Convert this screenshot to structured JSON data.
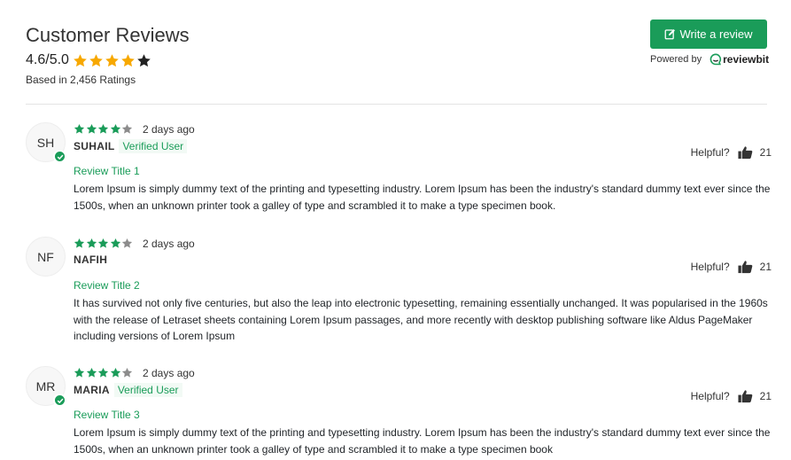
{
  "header": {
    "title": "Customer Reviews",
    "rating_value": "4.6/5.0",
    "rating_stars_filled": 4,
    "rating_stars_total": 5,
    "based_text": "Based in 2,456 Ratings",
    "write_review_label": "Write a review",
    "write_review_icon": "edit-icon",
    "powered_by": "Powered by",
    "logo_text": "reviewbit"
  },
  "colors": {
    "accent_green": "#1a9c59",
    "star_gold": "#f7a800",
    "star_dark": "#222222",
    "star_gray": "#8c8c8c"
  },
  "reviews": [
    {
      "initials": "SH",
      "stars_filled": 4,
      "date": "2 days ago",
      "name": "SUHAIL",
      "verified": "Verified User",
      "helpful_label": "Helpful?",
      "helpful_count": "21",
      "title": "Review Title 1",
      "body": "Lorem Ipsum is simply dummy text of the printing and typesetting industry. Lorem Ipsum has been the industry's standard dummy text ever since the 1500s, when an unknown printer took a galley of type and scrambled it to make a type specimen book."
    },
    {
      "initials": "NF",
      "stars_filled": 4,
      "date": "2 days ago",
      "name": "NAFIH",
      "verified": "",
      "helpful_label": "Helpful?",
      "helpful_count": "21",
      "title": "Review Title 2",
      "body": "It has survived not only five centuries, but also the leap into electronic typesetting, remaining essentially unchanged. It was popularised in the 1960s with the release of Letraset sheets containing Lorem Ipsum passages, and more recently with desktop publishing software like Aldus PageMaker including versions of Lorem Ipsum"
    },
    {
      "initials": "MR",
      "stars_filled": 4,
      "date": "2 days ago",
      "name": "MARIA",
      "verified": "Verified User",
      "helpful_label": "Helpful?",
      "helpful_count": "21",
      "title": "Review Title 3",
      "body": "Lorem Ipsum is simply dummy text of the printing and typesetting industry. Lorem Ipsum has been the industry's standard dummy text ever since the 1500s, when an unknown printer took a galley of type and scrambled it to make a type specimen book"
    }
  ]
}
